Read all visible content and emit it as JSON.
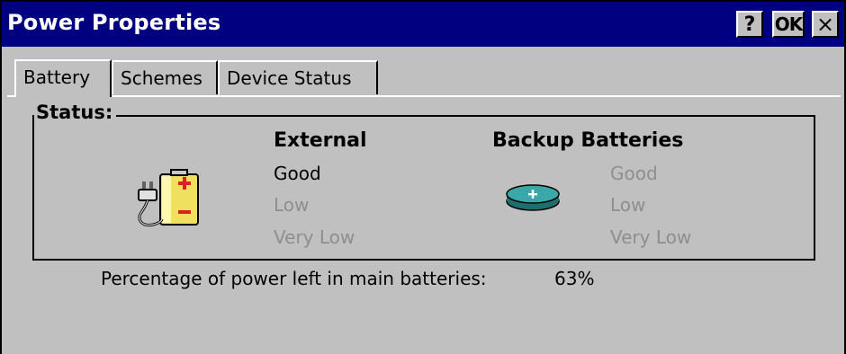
{
  "window": {
    "title": "Power Properties",
    "buttons": {
      "help": "?",
      "ok": "OK",
      "close": "×"
    }
  },
  "tabs": [
    {
      "label": "Battery",
      "selected": true
    },
    {
      "label": "Schemes",
      "selected": false
    },
    {
      "label": "Device Status",
      "selected": false
    }
  ],
  "status": {
    "group_label": "Status:",
    "external": {
      "heading": "External",
      "icon": "ac-plug-battery-icon",
      "levels": [
        {
          "label": "Good",
          "active": true
        },
        {
          "label": "Low",
          "active": false
        },
        {
          "label": "Very Low",
          "active": false
        }
      ]
    },
    "backup": {
      "heading": "Backup Batteries",
      "icon": "coin-cell-battery-icon",
      "levels": [
        {
          "label": "Good",
          "active": false
        },
        {
          "label": "Low",
          "active": false
        },
        {
          "label": "Very Low",
          "active": false
        }
      ]
    }
  },
  "main_battery": {
    "label": "Percentage of power left in main batteries:",
    "value": "63%"
  },
  "colors": {
    "titlebar": "#000080",
    "face": "#c0c0c0",
    "disabled_text": "#8e8e8e",
    "coin_cell": "#2a8f8f"
  }
}
